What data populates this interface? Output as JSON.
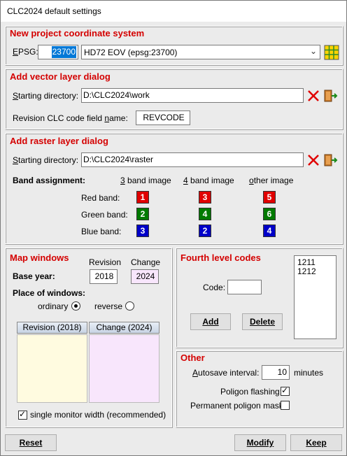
{
  "window": {
    "title": "CLC2024 default settings"
  },
  "coord": {
    "title": "New project coordinate system",
    "epsg_label": "EPSG:",
    "epsg_value": "23700",
    "crs_selected": "HD72 EOV (epsg:23700)",
    "grid_icon": "grid-icon"
  },
  "vector": {
    "title": "Add vector layer dialog",
    "dir_label": "Starting directory:",
    "dir_value": "D:\\CLC2024\\work",
    "field_label": "Revision CLC code field name:",
    "field_value": "REVCODE"
  },
  "raster": {
    "title": "Add raster layer dialog",
    "dir_label": "Starting directory:",
    "dir_value": "D:\\CLC2024\\raster",
    "band_assignment": "Band assignment:",
    "col_3band": "3 band image",
    "col_4band": "4 band image",
    "col_other": "other image",
    "rows": [
      {
        "label": "Red band:",
        "v3": "1",
        "v4": "3",
        "vo": "5",
        "color": "#e00000"
      },
      {
        "label": "Green band:",
        "v3": "2",
        "v4": "4",
        "vo": "6",
        "color": "#007a00"
      },
      {
        "label": "Blue band:",
        "v3": "3",
        "v4": "2",
        "vo": "4",
        "color": "#0000c8"
      }
    ]
  },
  "map": {
    "title": "Map windows",
    "revision_label": "Revision",
    "change_label": "Change",
    "base_year_label": "Base year:",
    "revision_year": "2018",
    "change_year": "2024",
    "place_label": "Place of windows:",
    "ordinary_label": "ordinary",
    "reverse_label": "reverse",
    "ordinary_selected": true,
    "pane_revision": "Revision (2018)",
    "pane_change": "Change (2024)",
    "single_monitor_label": "single monitor width (recommended)",
    "single_monitor_checked": true,
    "revision_color": "#fffbe0",
    "change_color": "#f8e6fc"
  },
  "fourth": {
    "title": "Fourth level codes",
    "code_label": "Code:",
    "code_value": "",
    "list": [
      "1211",
      "1212"
    ],
    "add_label": "Add",
    "delete_label": "Delete"
  },
  "other": {
    "title": "Other",
    "autosave_label": "Autosave interval:",
    "autosave_value": "10",
    "minutes_label": "minutes",
    "flashing_label": "Poligon flashing:",
    "flashing_checked": true,
    "mask_label": "Permanent poligon mask:",
    "mask_checked": false
  },
  "buttons": {
    "reset": "Reset",
    "modify": "Modify",
    "keep": "Keep"
  },
  "colors": {
    "accent_title": "#d40000",
    "epsg_highlight": "#0078d7"
  }
}
